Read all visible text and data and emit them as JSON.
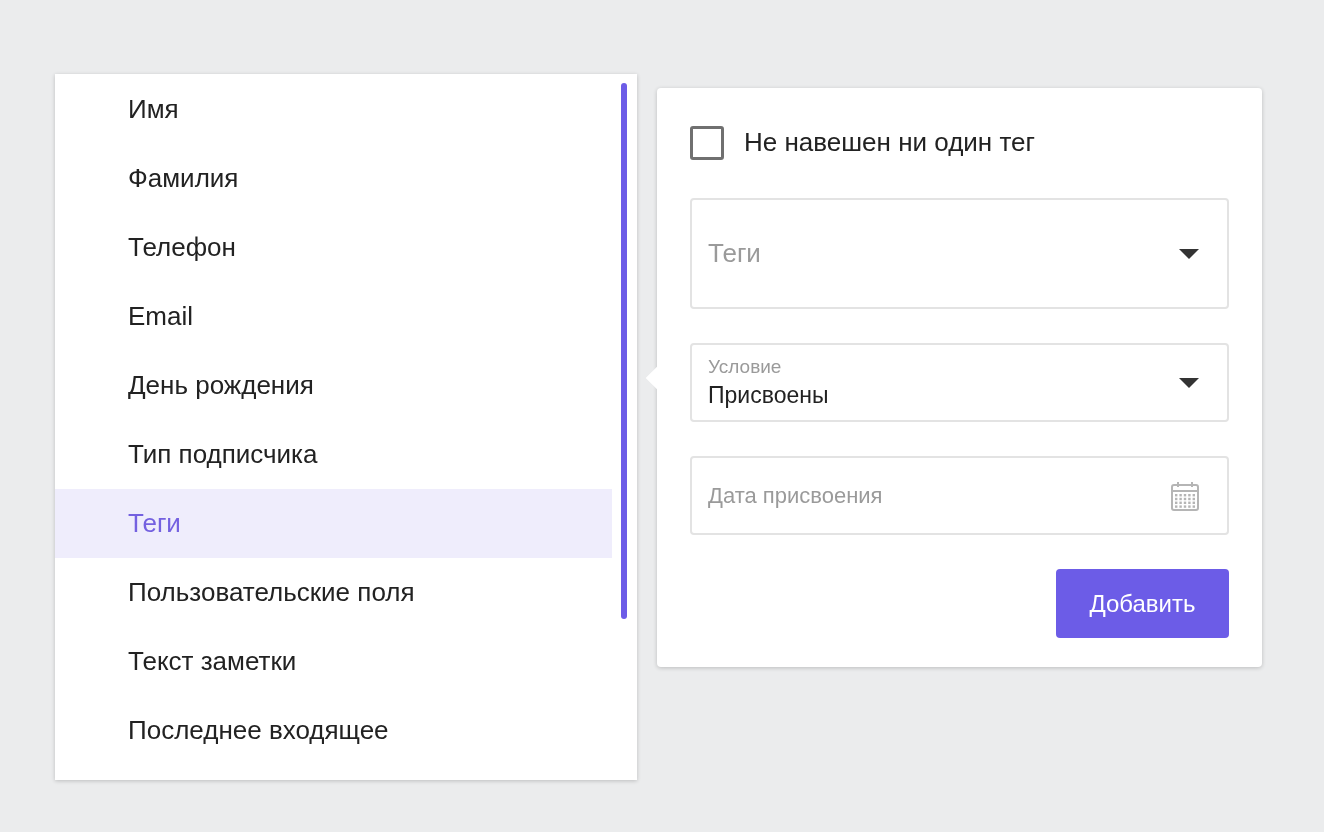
{
  "list": {
    "items": [
      {
        "label": "Имя",
        "selected": false
      },
      {
        "label": "Фамилия",
        "selected": false
      },
      {
        "label": "Телефон",
        "selected": false
      },
      {
        "label": "Email",
        "selected": false
      },
      {
        "label": "День рождения",
        "selected": false
      },
      {
        "label": "Тип подписчика",
        "selected": false
      },
      {
        "label": "Теги",
        "selected": true
      },
      {
        "label": "Пользовательские поля",
        "selected": false
      },
      {
        "label": "Текст заметки",
        "selected": false
      },
      {
        "label": "Последнее входящее",
        "selected": false
      }
    ]
  },
  "filter": {
    "checkbox": {
      "label": "Не навешен ни один тег",
      "checked": false
    },
    "tags_select": {
      "placeholder": "Теги"
    },
    "condition_select": {
      "label": "Условие",
      "value": "Присвоены"
    },
    "date_field": {
      "placeholder": "Дата присвоения"
    },
    "add_button": "Добавить"
  }
}
